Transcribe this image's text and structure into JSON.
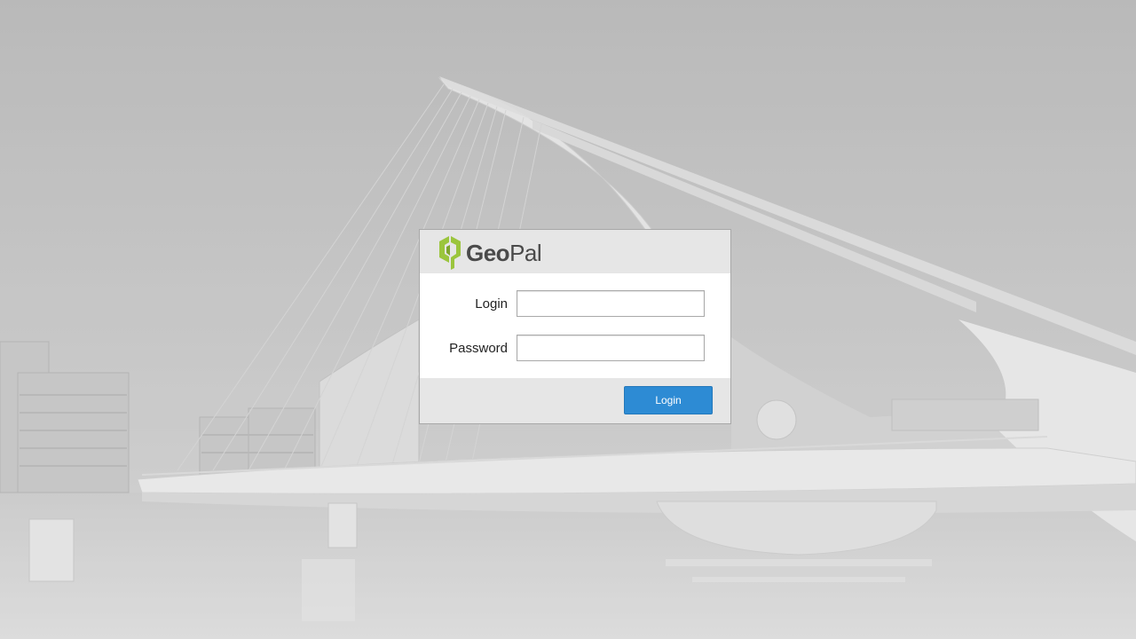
{
  "brand": {
    "name_part1": "Geo",
    "name_part2": "Pal",
    "logo_color": "#9bc53d",
    "text_color": "#4a4a4a"
  },
  "form": {
    "login_label": "Login",
    "login_value": "",
    "password_label": "Password",
    "password_value": "",
    "submit_label": "Login"
  },
  "colors": {
    "accent": "#2d8bd4",
    "panel": "#e6e6e6",
    "background": "#c4c4c4"
  }
}
